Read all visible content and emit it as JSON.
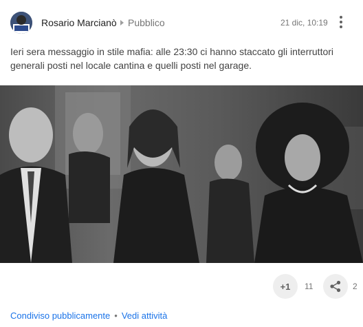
{
  "post": {
    "author": "Rosario Marcianò",
    "visibility": "Pubblico",
    "timestamp": "21 dic, 10:19",
    "text": "Ieri sera messaggio in stile mafia: alle 23:30 ci hanno staccato gli interruttori generali posti nel locale cantina e quelli posti nel garage."
  },
  "actions": {
    "plus_one_label": "+1",
    "plus_one_count": "11",
    "share_count": "2"
  },
  "footer": {
    "shared_label": "Condiviso pubblicamente",
    "separator": "•",
    "activity_label": "Vedi attività"
  },
  "icons": {
    "menu": "more-vert-icon",
    "share": "share-icon",
    "visibility": "chevron-right-icon"
  },
  "colors": {
    "link": "#1a73e8",
    "muted": "#757575",
    "button_bg": "#eeeeee"
  }
}
